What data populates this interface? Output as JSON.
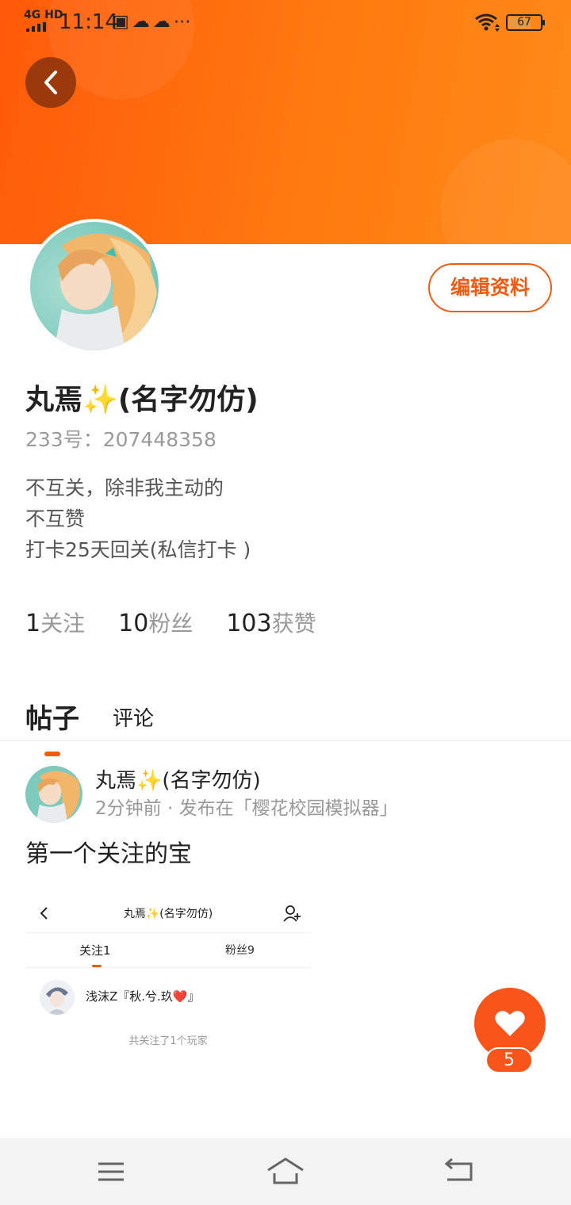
{
  "status_bar": {
    "network": "4G HD",
    "time": "11:14",
    "notification_icons": [
      "app-icon",
      "cloud-icon",
      "cloud-icon",
      "more-icon"
    ],
    "battery_level": 67,
    "battery_text": "67"
  },
  "header": {
    "back_icon": "chevron-left-icon",
    "background_color": "#ff6a10"
  },
  "profile": {
    "edit_button": "编辑资料",
    "name": "丸焉✨(名字勿仿)",
    "id_text": "233号：207448358",
    "bio_lines": [
      "不互关，除非我主动的",
      "不互赞",
      "打卡25天回关(私信打卡 )"
    ],
    "stats": [
      {
        "value": "1",
        "label": "关注"
      },
      {
        "value": "10",
        "label": "粉丝"
      },
      {
        "value": "103",
        "label": "获赞"
      }
    ]
  },
  "tabs": {
    "active": "帖子",
    "other": "评论"
  },
  "post": {
    "author": "丸焉✨(名字勿仿)",
    "meta": "2分钟前 · 发布在「樱花校园模拟器」",
    "text": "第一个关注的宝",
    "embedded_screenshot": {
      "title": "丸焉✨(名字勿仿)",
      "tab_following": "关注1",
      "tab_followers": "粉丝9",
      "follow_name": "浅沫Z『秋.兮.玖❤️』",
      "footer": "共关注了1个玩家"
    }
  },
  "like": {
    "count": "5",
    "icon": "heart-icon"
  },
  "nav_bar": {
    "items": [
      "menu-icon",
      "home-icon",
      "back-icon"
    ]
  },
  "colors": {
    "accent": "#f15a0f",
    "header_gradient_start": "#ff5a0a",
    "header_gradient_end": "#ff8a1a"
  }
}
